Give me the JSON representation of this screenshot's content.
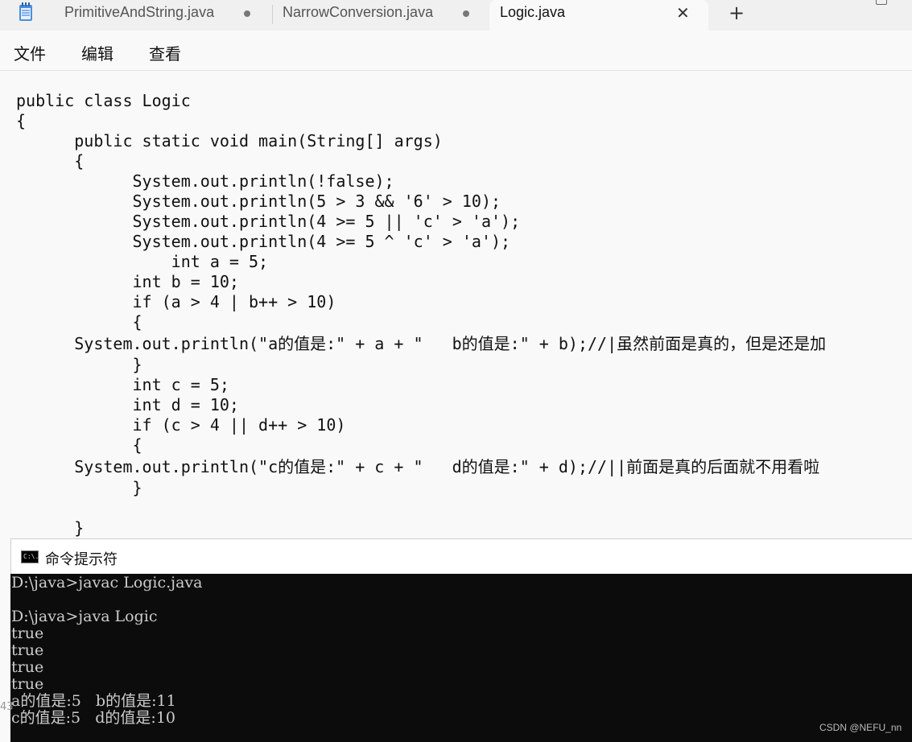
{
  "tabs": [
    {
      "label": "PrimitiveAndString.java",
      "modified": true
    },
    {
      "label": "NarrowConversion.java",
      "modified": true
    },
    {
      "label": "Logic.java",
      "active": true
    }
  ],
  "menu": [
    "文件",
    "编辑",
    "查看"
  ],
  "code": [
    "public class Logic",
    "{",
    "      public static void main(String[] args)",
    "      {",
    "            System.out.println(!false);",
    "            System.out.println(5 > 3 && '6' > 10);",
    "            System.out.println(4 >= 5 || 'c' > 'a');",
    "            System.out.println(4 >= 5 ^ 'c' > 'a');",
    "                int a = 5;",
    "            int b = 10;",
    "            if (a > 4 | b++ > 10)",
    "            {",
    "      System.out.println(\"a的值是:\" + a + \"   b的值是:\" + b);//|虽然前面是真的，但是还是加",
    "            }",
    "            int c = 5;",
    "            int d = 10;",
    "            if (c > 4 || d++ > 10)",
    "            {",
    "      System.out.println(\"c的值是:\" + c + \"   d的值是:\" + d);//||前面是真的后面就不用看啦",
    "            }",
    "",
    "      }"
  ],
  "cmd": {
    "title": "命令提示符",
    "icon_text": "C:\\.",
    "output": [
      "D:\\java>javac Logic.java",
      "",
      "D:\\java>java Logic",
      "true",
      "true",
      "true",
      "true",
      "a的值是:5   b的值是:11",
      "c的值是:5   d的值是:10"
    ]
  },
  "side_number": "43",
  "watermark": "CSDN @NEFU_nn"
}
